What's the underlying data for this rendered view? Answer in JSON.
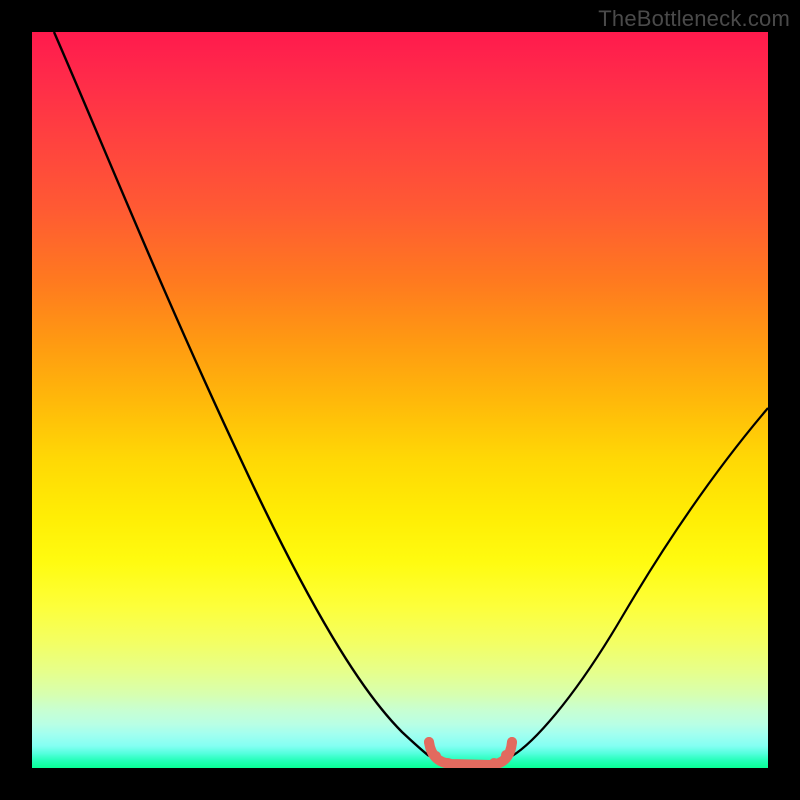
{
  "watermark": "TheBottleneck.com",
  "colors": {
    "frame": "#000000",
    "curve_line": "#000000",
    "marker_stroke": "#e26a5f",
    "marker_fill": "#e26a5f"
  },
  "chart_data": {
    "type": "line",
    "title": "",
    "xlabel": "",
    "ylabel": "",
    "xlim": [
      0,
      100
    ],
    "ylim": [
      0,
      100
    ],
    "grid": false,
    "legend": false,
    "background": "rainbow vertical gradient red→yellow→green",
    "series": [
      {
        "name": "left-branch",
        "x": [
          3,
          10,
          20,
          30,
          40,
          47,
          50,
          52,
          53.5
        ],
        "y": [
          100,
          84,
          62,
          41,
          22,
          10,
          5,
          2,
          1
        ]
      },
      {
        "name": "valley-flat-markers",
        "x": [
          53.5,
          55,
          57,
          59,
          61,
          63,
          65
        ],
        "y": [
          1,
          0.3,
          0.1,
          0.1,
          0.1,
          0.3,
          1
        ]
      },
      {
        "name": "right-branch",
        "x": [
          65,
          68,
          74,
          82,
          90,
          100
        ],
        "y": [
          1,
          3,
          9,
          21,
          34,
          49
        ]
      }
    ],
    "annotations": [
      {
        "text": "TheBottleneck.com",
        "position": "top-right"
      }
    ]
  }
}
